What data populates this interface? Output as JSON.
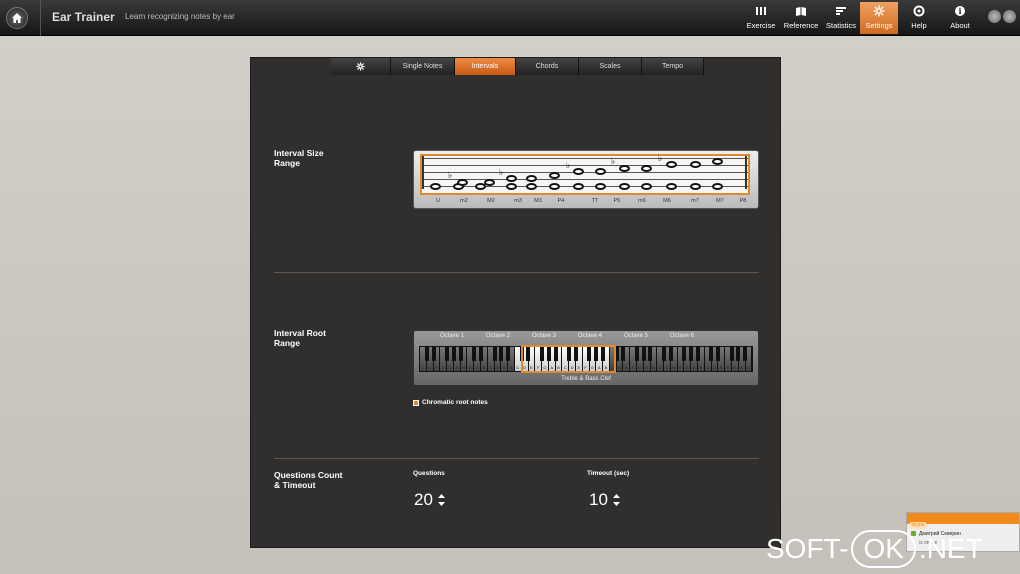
{
  "app": {
    "title": "Ear Trainer",
    "subtitle": "Learn recognizing notes by ear"
  },
  "nav": [
    {
      "label": "Exercise",
      "icon": "piano-icon",
      "active": false
    },
    {
      "label": "Reference",
      "icon": "book-icon",
      "active": false
    },
    {
      "label": "Statistics",
      "icon": "bars-icon",
      "active": false
    },
    {
      "label": "Settings",
      "icon": "gear-icon",
      "active": true
    },
    {
      "label": "Help",
      "icon": "lifebuoy-icon",
      "active": false
    },
    {
      "label": "About",
      "icon": "info-icon",
      "active": false
    }
  ],
  "colors": {
    "accent": "#e08a2c",
    "panel": "#312f2d",
    "topbar": "#1e1e1e"
  },
  "tabs": [
    {
      "label": "",
      "icon": "gear-icon",
      "active": false
    },
    {
      "label": "Single Notes",
      "active": false
    },
    {
      "label": "Intervals",
      "active": true
    },
    {
      "label": "Chords",
      "active": false
    },
    {
      "label": "Scales",
      "active": false
    },
    {
      "label": "Tempo",
      "active": false
    }
  ],
  "sections": {
    "interval_size": "Interval Size\nRange",
    "interval_root": "Interval Root\nRange",
    "questions": "Questions Count\n& Timeout"
  },
  "interval_labels": [
    "U",
    "m2",
    "M2",
    "m3",
    "M3",
    "P4",
    "TT",
    "P5",
    "m6",
    "M6",
    "m7",
    "M7",
    "P8"
  ],
  "octave_labels": [
    "Octave 1",
    "Octave 2",
    "Octave 3",
    "Octave 4",
    "Octave 5",
    "Octave 6"
  ],
  "key_letters": [
    "C",
    "D",
    "E",
    "F",
    "G",
    "A",
    "B"
  ],
  "clef_label": "Treble & Bass Clef",
  "chromatic": {
    "label": "Chromatic root notes",
    "checked": true
  },
  "questions": {
    "label": "Questions",
    "value": "20"
  },
  "timeout": {
    "label": "Timeout (sec)",
    "value": "10"
  },
  "skype": {
    "logo": "skype",
    "name": "Дмитрий Северин",
    "status": "is online"
  },
  "watermark": {
    "left": "SOFT-",
    "mid": "OK",
    "right": ".NET"
  }
}
